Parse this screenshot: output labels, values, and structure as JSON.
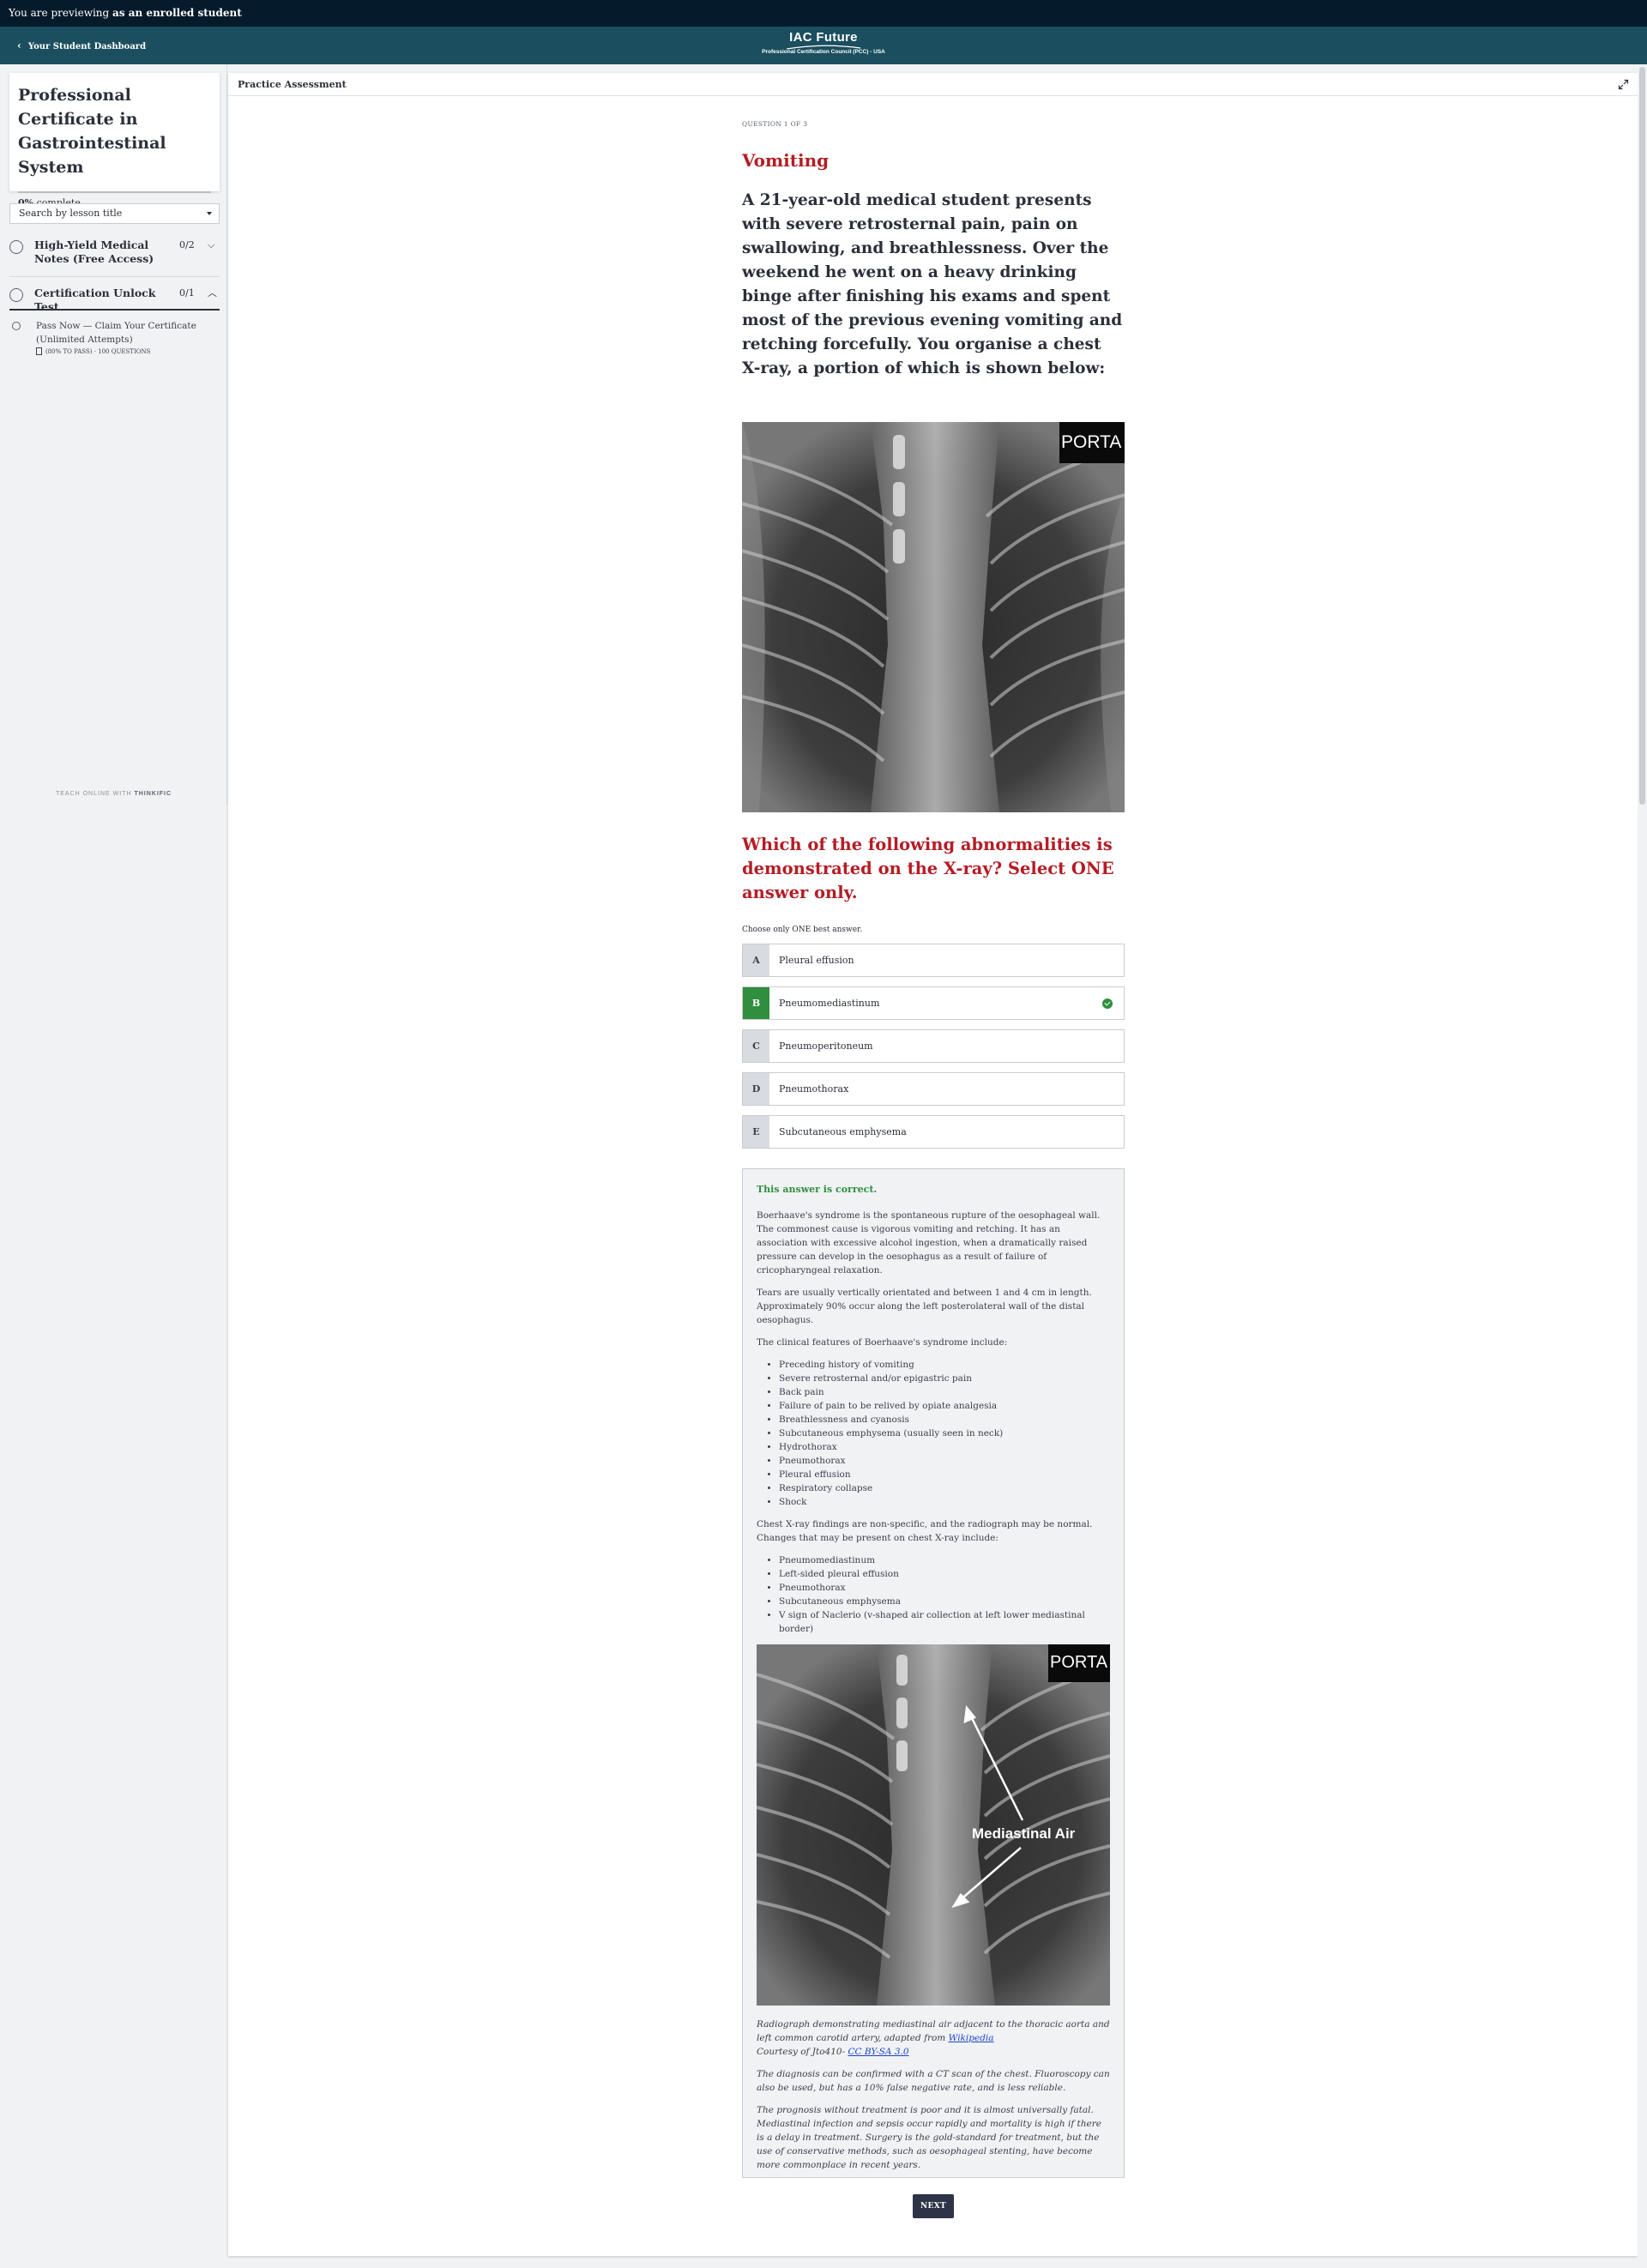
{
  "preview_bar": {
    "prefix": "You are previewing",
    "suffix": "as an enrolled student"
  },
  "header": {
    "back_label": "Your Student Dashboard",
    "brand_name": "IAC Future",
    "brand_sub": "Professional Certification Council (PCC) - USA"
  },
  "sidebar": {
    "course_title": "Professional Certificate in Gastrointestinal System",
    "progress_percent": "0%",
    "progress_label": "complete",
    "search_placeholder": "Search by lesson title",
    "chapters": [
      {
        "title": "High-Yield Medical Notes (Free Access)",
        "count": "0/2",
        "expanded": false
      },
      {
        "title": "Certification Unlock Test",
        "count": "0/1",
        "expanded": true
      }
    ],
    "lessons": [
      {
        "title": "Pass Now — Claim Your Certificate (Unlimited Attempts)",
        "meta": "(80% TO PASS) · 100 QUESTIONS"
      }
    ],
    "footer_prefix": "TEACH ONLINE WITH",
    "footer_brand": "THINKIFIC"
  },
  "main": {
    "header_title": "Practice Assessment",
    "question_number": "QUESTION 1 OF 3",
    "topic": "Vomiting",
    "stem": "A 21-year-old medical student presents with severe retrosternal pain, pain on swallowing, and breathlessness. Over the weekend he went on a heavy drinking binge after finishing his exams and spent most of the previous evening vomiting and retching forcefully. You organise a chest X-ray, a portion of which is shown below:",
    "image_overlay_text": "PORTA",
    "question": "Which of the following abnormalities is demonstrated on the X-ray? Select ONE answer only.",
    "instruction": "Choose only ONE best answer.",
    "answers": [
      {
        "letter": "A",
        "text": "Pleural effusion",
        "correct": false
      },
      {
        "letter": "B",
        "text": "Pneumomediastinum",
        "correct": true
      },
      {
        "letter": "C",
        "text": "Pneumoperitoneum",
        "correct": false
      },
      {
        "letter": "D",
        "text": "Pneumothorax",
        "correct": false
      },
      {
        "letter": "E",
        "text": "Subcutaneous emphysema",
        "correct": false
      }
    ],
    "feedback": {
      "status": "This answer is correct.",
      "p1": "Boerhaave's syndrome is the spontaneous rupture of the oesophageal wall. The commonest cause is vigorous vomiting and retching. It has an association with excessive alcohol ingestion, when a dramatically raised pressure can develop in the oesophagus as a result of failure of cricopharyngeal relaxation.",
      "p2": "Tears are usually vertically orientated and between 1 and 4 cm in length. Approximately 90% occur along the left posterolateral wall of the distal oesophagus.",
      "p3": "The clinical features of Boerhaave's syndrome include:",
      "features": [
        "Preceding history of vomiting",
        "Severe retrosternal and/or epigastric pain",
        "Back pain",
        "Failure of pain to be relived by opiate analgesia",
        "Breathlessness and cyanosis",
        "Subcutaneous emphysema (usually seen in neck)",
        "Hydrothorax",
        "Pneumothorax",
        "Pleural effusion",
        "Respiratory collapse",
        "Shock"
      ],
      "p4": "Chest X-ray findings are non-specific, and the radiograph may be normal. Changes that may be present on chest X-ray include:",
      "findings": [
        "Pneumomediastinum",
        "Left-sided pleural effusion",
        "Pneumothorax",
        "Subcutaneous emphysema",
        "V sign of Naclerio (v-shaped air collection at left lower mediastinal border)"
      ],
      "image_label": "Mediastinal Air",
      "caption_1": "Radiograph demonstrating mediastinal air adjacent to the thoracic aorta and left common carotid artery, adapted from ",
      "caption_link": "Wikipedia",
      "caption_2": "Courtesy of Jto410- ",
      "caption_license": "CC BY-SA 3.0",
      "p5": "The diagnosis can be confirmed with a CT scan of the chest. Fluoroscopy can also be used, but has a 10% false negative rate, and is less reliable.",
      "p6": "The prognosis without treatment is poor and it is almost universally fatal. Mediastinal infection and sepsis occur rapidly and mortality is high if there is a delay in treatment. Surgery is the gold-standard for treatment, but the use of conservative methods, such as oesophageal stenting, have become more commonplace in recent years."
    },
    "next_label": "NEXT"
  },
  "colors": {
    "accent_red": "#b51c24",
    "correct_green": "#2f8f3e",
    "header_teal": "#1b4f5f",
    "preview_navy": "#051a2a",
    "button_navy": "#2e3447"
  }
}
